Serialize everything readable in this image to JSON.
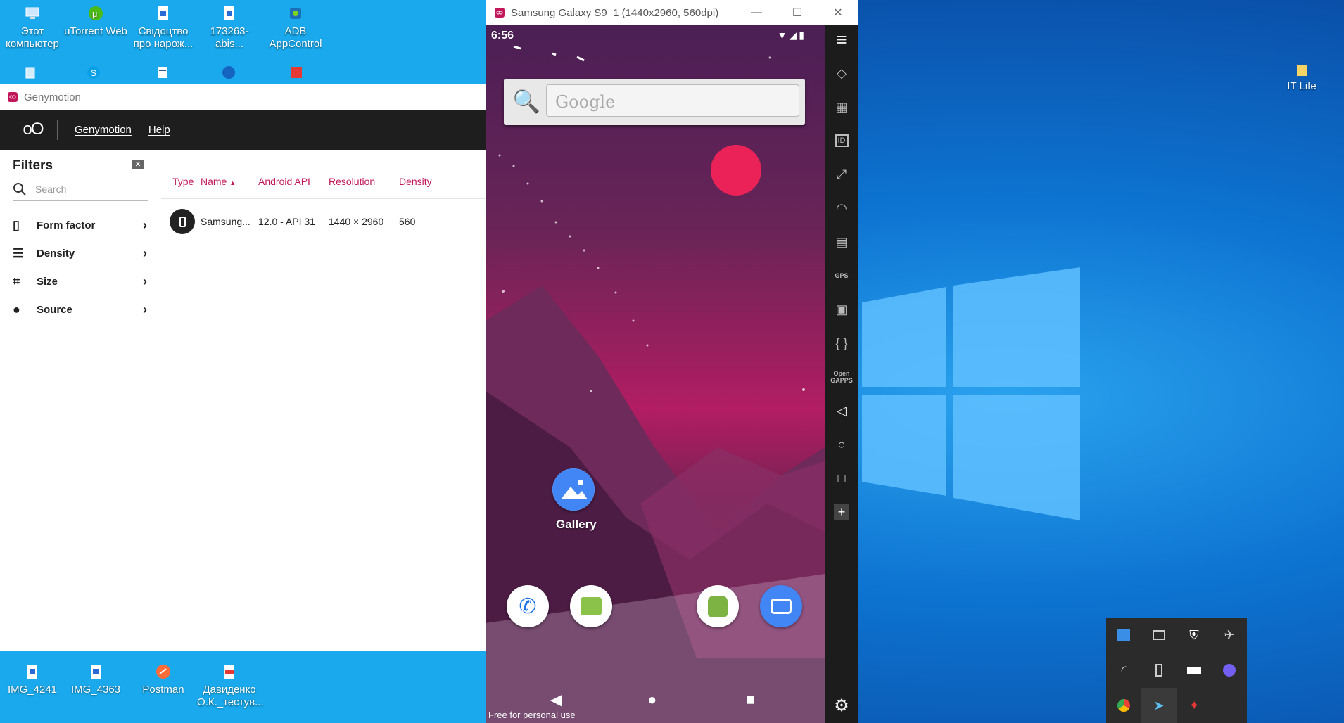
{
  "desktop": {
    "icons_top": [
      {
        "label": "Этот компьютер",
        "icon": "computer-icon"
      },
      {
        "label": "uTorrent Web",
        "icon": "utorrent-icon"
      },
      {
        "label": "Свідоцтво про нарож...",
        "icon": "document-icon"
      },
      {
        "label": "173263-abis...",
        "icon": "document-icon"
      },
      {
        "label": "ADB AppControl",
        "icon": "adb-icon"
      }
    ],
    "icons_bottom": [
      {
        "label": "IMG_4241",
        "icon": "image-icon"
      },
      {
        "label": "IMG_4363",
        "icon": "image-icon"
      },
      {
        "label": "Postman",
        "icon": "postman-icon"
      },
      {
        "label": "Давиденко О.К._тестув...",
        "icon": "pdf-icon"
      }
    ],
    "right_icon": {
      "label": "IT Life",
      "icon": "folder-icon"
    }
  },
  "genymotion": {
    "title": "Genymotion",
    "logo": "oO",
    "menu": [
      "Genymotion",
      "Help"
    ],
    "filters": {
      "title": "Filters",
      "search_placeholder": "Search",
      "items": [
        {
          "label": "Form factor",
          "icon": "phone-icon"
        },
        {
          "label": "Density",
          "icon": "sliders-icon"
        },
        {
          "label": "Size",
          "icon": "crop-icon"
        },
        {
          "label": "Source",
          "icon": "person-icon"
        }
      ]
    },
    "table": {
      "columns": [
        "Type",
        "Name",
        "Android API",
        "Resolution",
        "Density"
      ],
      "sort_indicator": "▲",
      "rows": [
        {
          "name": "Samsung...",
          "api": "12.0 - API 31",
          "resolution": "1440 × 2960",
          "density": "560"
        }
      ]
    }
  },
  "emulator": {
    "title": "Samsung Galaxy S9_1 (1440x2960, 560dpi) - 1...",
    "time": "6:56",
    "search_hint": "Google",
    "gallery_label": "Gallery",
    "free_label": "Free for personal use",
    "toolbar_icons": [
      "menu-icon",
      "rotate-icon",
      "clapper-icon",
      "id-icon",
      "scale-icon",
      "cast-icon",
      "sim-icon",
      "gps-icon",
      "media-icon",
      "code-icon",
      "opengapps-icon",
      "back-icon",
      "home-icon",
      "recents-icon",
      "plus-icon",
      "settings-icon"
    ],
    "toolbar_text": {
      "id": "ID",
      "gps": "GPS",
      "opengapps": "Open GAPPS"
    }
  },
  "colors": {
    "accent": "#c2185b",
    "desktop": "#0a78d4",
    "left_bg": "#19a9ec"
  }
}
